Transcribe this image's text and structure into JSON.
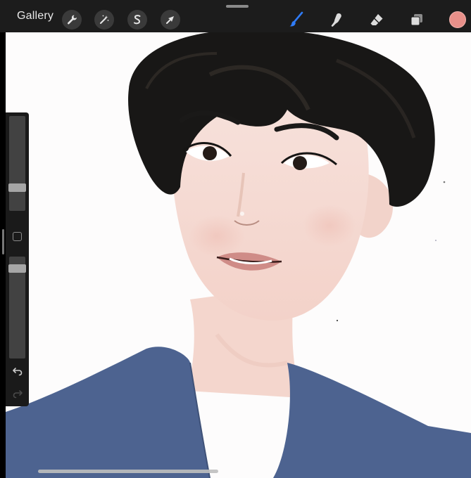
{
  "app": {
    "gallery_label": "Gallery",
    "active_tool": "brush",
    "current_color": "#e8908a"
  },
  "toolbar_left": [
    {
      "name": "actions",
      "icon": "wrench-icon"
    },
    {
      "name": "adjustments",
      "icon": "magic-wand-icon"
    },
    {
      "name": "selection",
      "icon": "selection-s-icon"
    },
    {
      "name": "transform",
      "icon": "arrow-cursor-icon"
    }
  ],
  "toolbar_right": [
    {
      "name": "paint",
      "icon": "brush-icon",
      "active": true
    },
    {
      "name": "smudge",
      "icon": "smudge-finger-icon"
    },
    {
      "name": "erase",
      "icon": "eraser-icon"
    },
    {
      "name": "layers",
      "icon": "layers-icon"
    },
    {
      "name": "colors",
      "icon": "color-swatch"
    }
  ],
  "sidebar": {
    "brush_size_level": 0.22,
    "opacity_level": 0.92,
    "undo_icon": "undo-icon",
    "redo_icon": "redo-icon",
    "modify_icon": "square-icon"
  },
  "palette": {
    "accent": "#2f7bf6",
    "shirt": "#4d6390",
    "skin": "#f6ddd6",
    "hair": "#161616"
  }
}
